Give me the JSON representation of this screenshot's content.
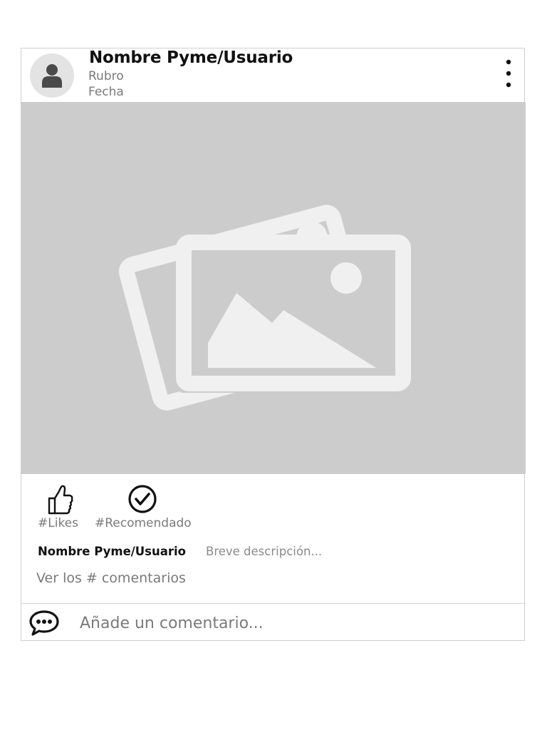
{
  "post": {
    "author_name": "Nombre Pyme/Usuario",
    "category": "Rubro",
    "date": "Fecha",
    "media": {
      "type": "image-placeholder",
      "icon": "image-placeholder-icon",
      "background": "#cccccc"
    },
    "actions": {
      "likes_label": "#Likes",
      "recommended_label": "#Recomendado",
      "like_icon": "thumbs-up-icon",
      "recommended_icon": "check-circle-icon"
    },
    "description": {
      "author": "Nombre Pyme/Usuario",
      "text": "Breve descripción..."
    },
    "view_comments": "Ver los # comentarios",
    "comment_input": {
      "placeholder": "Añade un comentario...",
      "value": "",
      "icon": "speech-bubble-icon"
    },
    "menu_icon": "more-vertical-icon",
    "avatar_icon": "user-icon"
  },
  "colors": {
    "text_primary": "#111111",
    "text_secondary": "#7a7a7a",
    "media_background": "#cccccc",
    "placeholder_light": "#f0f0f0",
    "avatar_background": "#e3e3e3",
    "border": "#cfcfcf"
  }
}
